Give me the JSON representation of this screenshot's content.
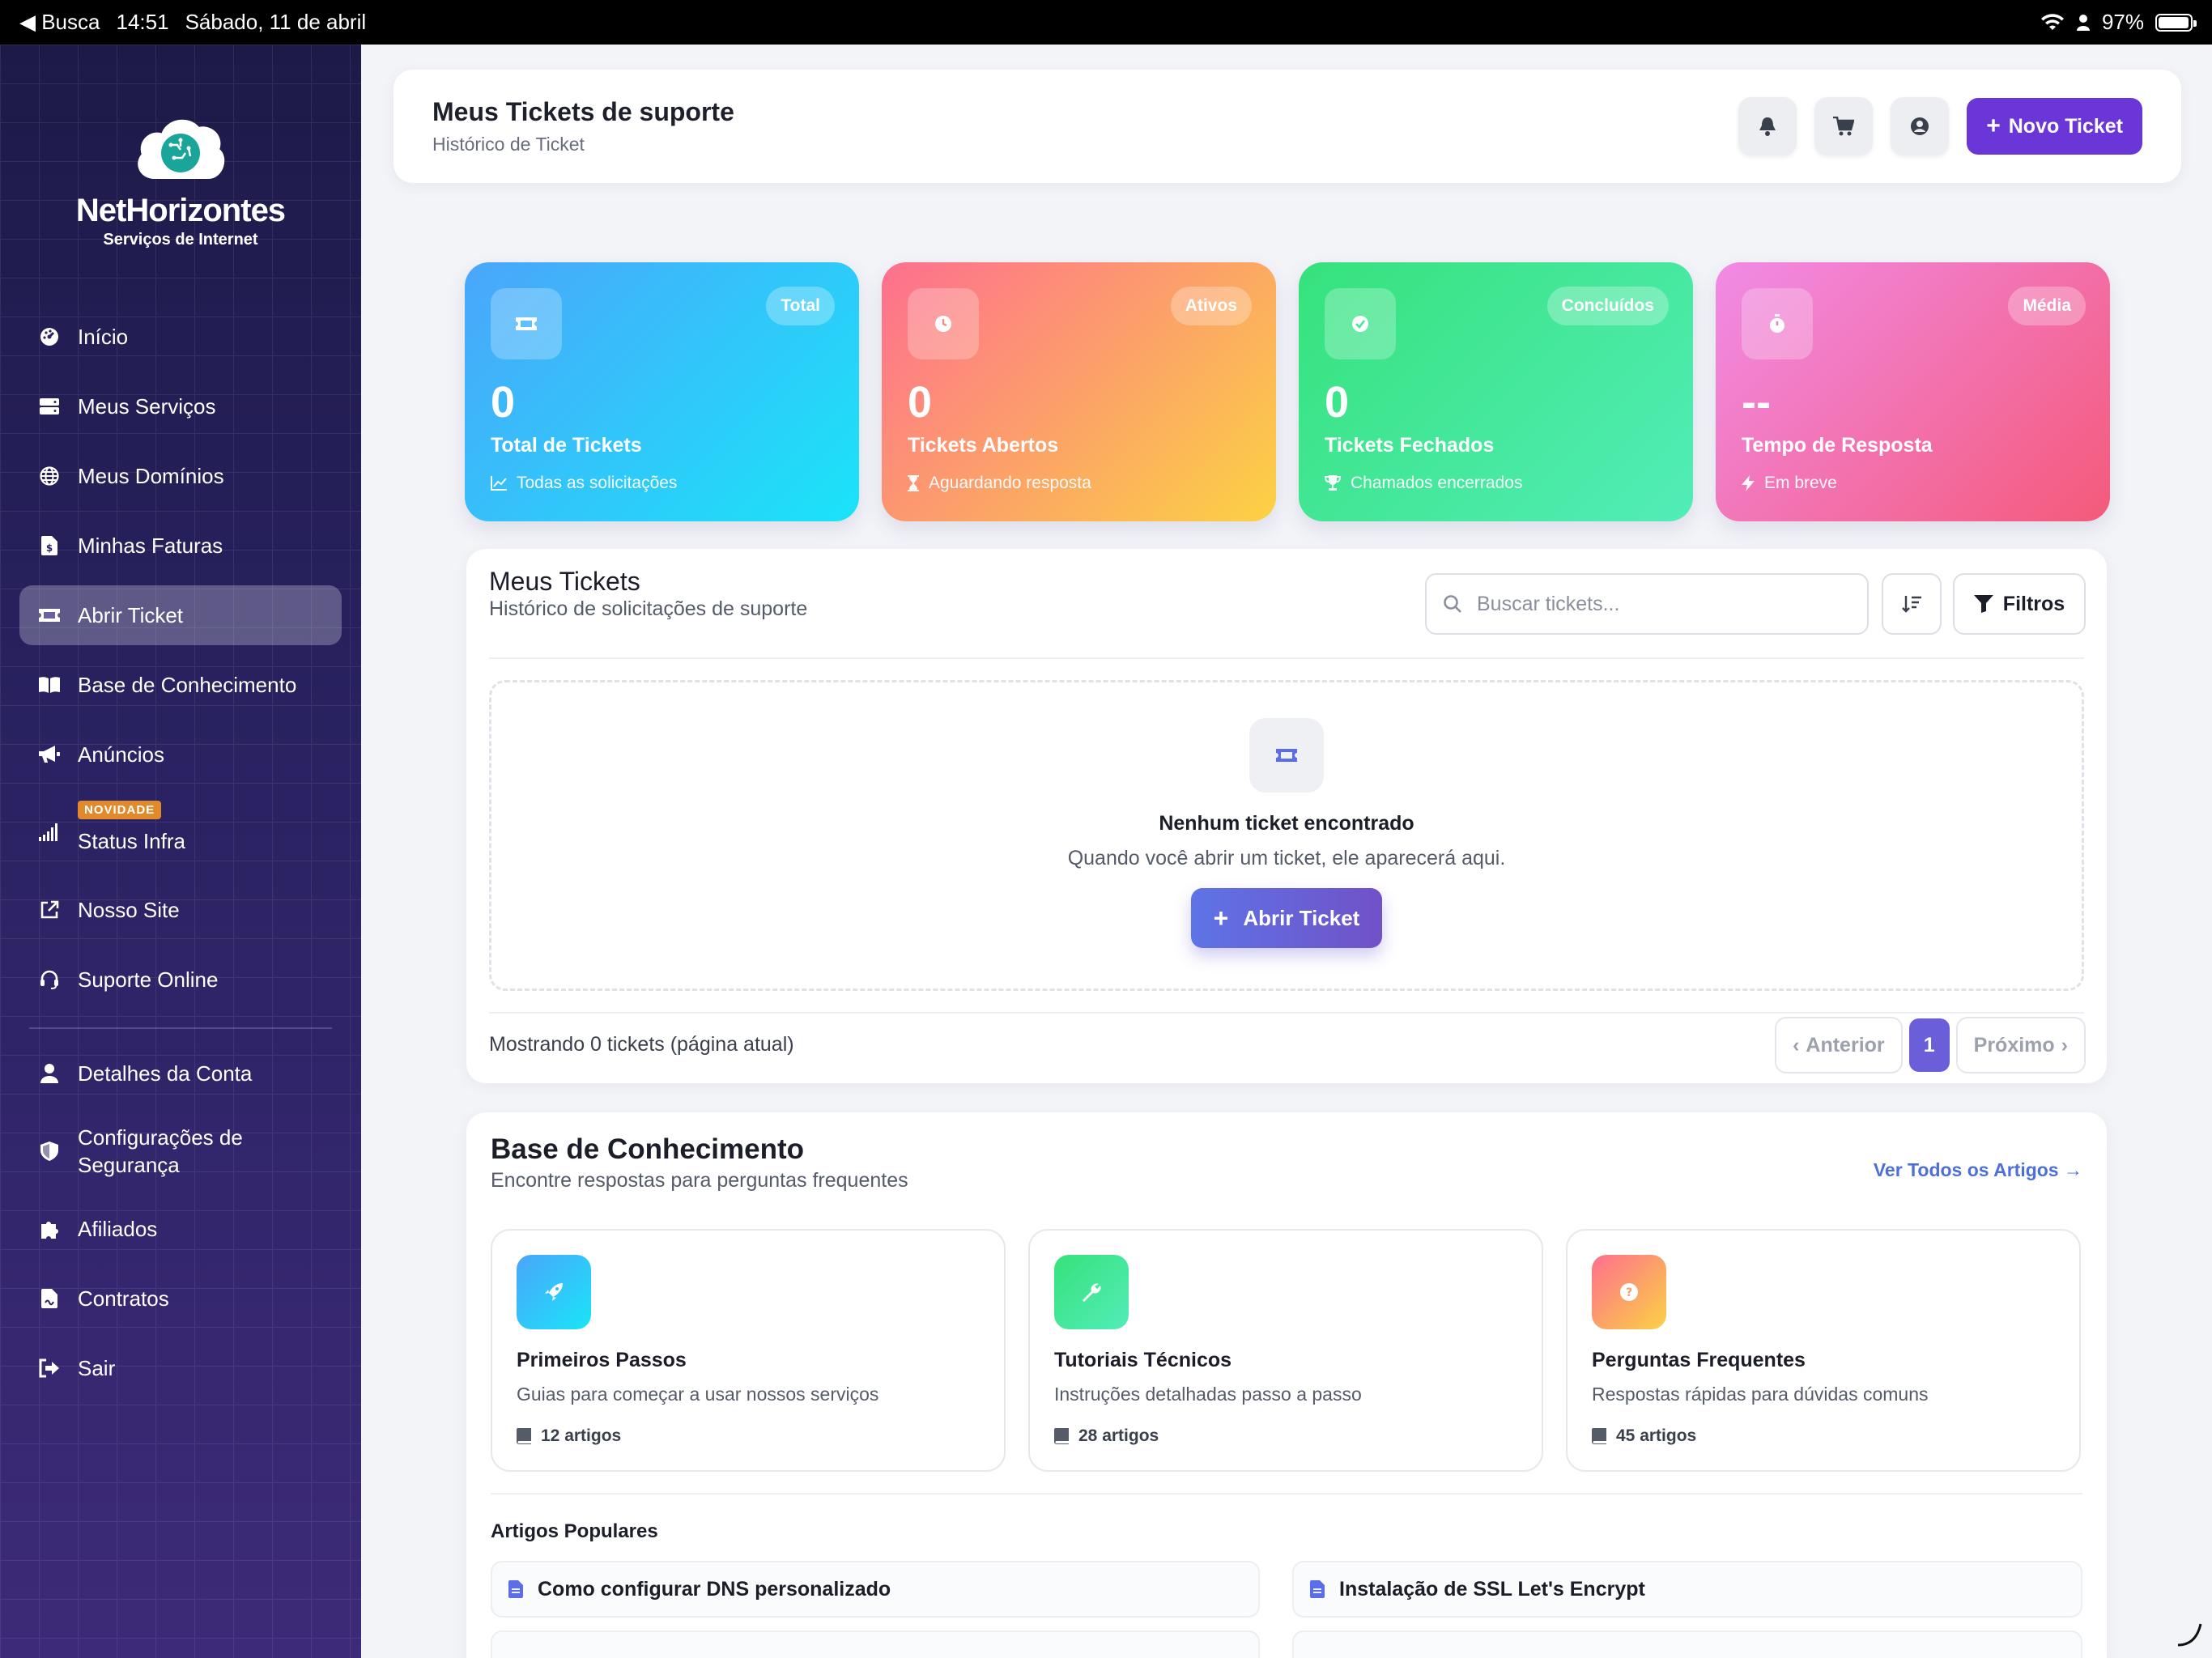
{
  "status_bar": {
    "back": "Busca",
    "time": "14:51",
    "date": "Sábado, 11 de abril",
    "battery": "97%",
    "battery_level": 0.97
  },
  "brand": {
    "name": "NetHorizontes",
    "tagline": "Serviços de Internet"
  },
  "sidebar": {
    "items": [
      {
        "label": "Início",
        "icon": "dashboard-icon"
      },
      {
        "label": "Meus Serviços",
        "icon": "server-icon"
      },
      {
        "label": "Meus Domínios",
        "icon": "globe-icon"
      },
      {
        "label": "Minhas Faturas",
        "icon": "invoice-icon"
      },
      {
        "label": "Abrir Ticket",
        "icon": "ticket-icon",
        "active": true
      },
      {
        "label": "Base de Conhecimento",
        "icon": "book-icon"
      },
      {
        "label": "Anúncios",
        "icon": "megaphone-icon"
      },
      {
        "label": "Status Infra",
        "icon": "signal-icon",
        "badge": "NOVIDADE"
      },
      {
        "label": "Nosso Site",
        "icon": "external-link-icon"
      },
      {
        "label": "Suporte Online",
        "icon": "headset-icon"
      }
    ],
    "account_items": [
      {
        "label": "Detalhes da Conta",
        "icon": "user-icon"
      },
      {
        "label": "Configurações de Segurança",
        "icon": "shield-icon"
      },
      {
        "label": "Afiliados",
        "icon": "puzzle-icon"
      },
      {
        "label": "Contratos",
        "icon": "contract-icon"
      },
      {
        "label": "Sair",
        "icon": "logout-icon"
      }
    ]
  },
  "header": {
    "title": "Meus Tickets de suporte",
    "subtitle": "Histórico de Ticket",
    "new_ticket_label": "Novo Ticket"
  },
  "stats": [
    {
      "pill": "Total",
      "value": "0",
      "label": "Total de Tickets",
      "sub": "Todas as solicitações",
      "icon": "ticket-icon",
      "sub_icon": "chart-line-icon"
    },
    {
      "pill": "Ativos",
      "value": "0",
      "label": "Tickets Abertos",
      "sub": "Aguardando resposta",
      "icon": "clock-icon",
      "sub_icon": "hourglass-icon"
    },
    {
      "pill": "Concluídos",
      "value": "0",
      "label": "Tickets Fechados",
      "sub": "Chamados encerrados",
      "icon": "check-circle-icon",
      "sub_icon": "trophy-icon"
    },
    {
      "pill": "Média",
      "value": "--",
      "label": "Tempo de Resposta",
      "sub": "Em breve",
      "icon": "stopwatch-icon",
      "sub_icon": "bolt-icon"
    }
  ],
  "tickets": {
    "title": "Meus Tickets",
    "subtitle": "Histórico de solicitações de suporte",
    "search_placeholder": "Buscar tickets...",
    "filters_label": "Filtros",
    "empty_title": "Nenhum ticket encontrado",
    "empty_text": "Quando você abrir um ticket, ele aparecerá aqui.",
    "empty_button": "Abrir Ticket",
    "footer_text": "Mostrando 0 tickets (página atual)",
    "prev_label": "Anterior",
    "next_label": "Próximo",
    "current_page": "1"
  },
  "knowledge_base": {
    "title": "Base de Conhecimento",
    "subtitle": "Encontre respostas para perguntas frequentes",
    "view_all": "Ver Todos os Artigos",
    "cards": [
      {
        "title": "Primeiros Passos",
        "desc": "Guias para começar a usar nossos serviços",
        "count": "12 artigos",
        "icon": "rocket-icon"
      },
      {
        "title": "Tutoriais Técnicos",
        "desc": "Instruções detalhadas passo a passo",
        "count": "28 artigos",
        "icon": "wrench-icon"
      },
      {
        "title": "Perguntas Frequentes",
        "desc": "Respostas rápidas para dúvidas comuns",
        "count": "45 artigos",
        "icon": "question-icon"
      }
    ],
    "popular_title": "Artigos Populares",
    "popular": [
      "Como configurar DNS personalizado",
      "Instalação de SSL Let's Encrypt"
    ]
  },
  "colors": {
    "accent": "#6a36d8",
    "sidebar_top": "#1d1a48",
    "sidebar_bottom": "#3d2a78",
    "link": "#4d6fd9"
  }
}
